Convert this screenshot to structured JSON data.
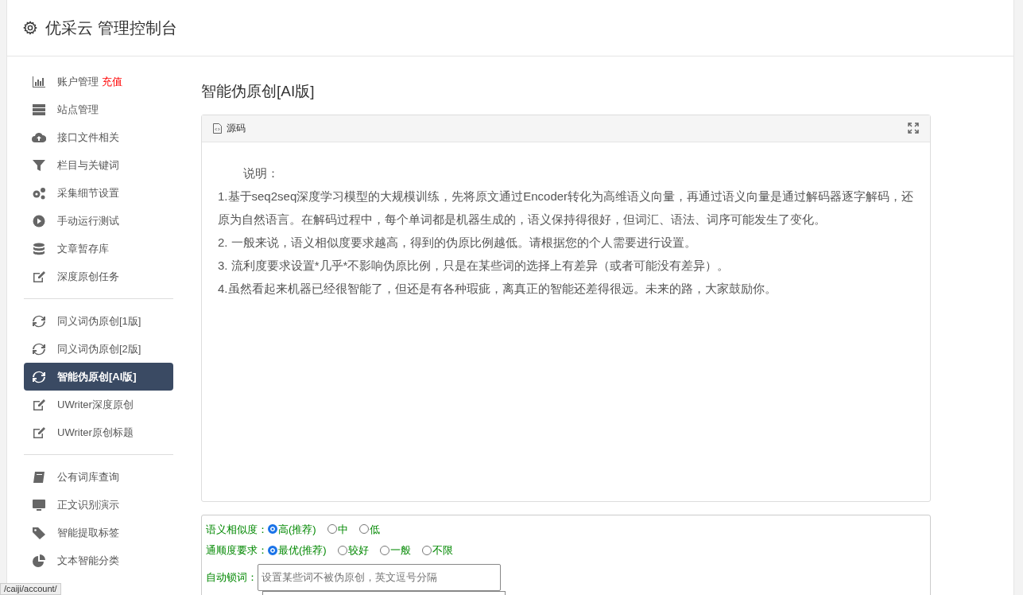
{
  "header": {
    "title": "优采云 管理控制台"
  },
  "sidebar": {
    "groups": [
      [
        {
          "label": "账户管理",
          "badge": "充值",
          "selected": false
        },
        {
          "label": "站点管理",
          "selected": false
        },
        {
          "label": "接口文件相关",
          "selected": false
        },
        {
          "label": "栏目与关键词",
          "selected": false
        },
        {
          "label": "采集细节设置",
          "selected": false
        },
        {
          "label": "手动运行测试",
          "selected": false
        },
        {
          "label": "文章暂存库",
          "selected": false
        },
        {
          "label": "深度原创任务",
          "selected": false
        }
      ],
      [
        {
          "label": "同义词伪原创[1版]",
          "selected": false
        },
        {
          "label": "同义词伪原创[2版]",
          "selected": false
        },
        {
          "label": "智能伪原创[AI版]",
          "selected": true
        },
        {
          "label": "UWriter深度原创",
          "selected": false
        },
        {
          "label": "UWriter原创标题",
          "selected": false
        }
      ],
      [
        {
          "label": "公有词库查询",
          "selected": false
        },
        {
          "label": "正文识别演示",
          "selected": false
        },
        {
          "label": "智能提取标签",
          "selected": false
        },
        {
          "label": "文本智能分类",
          "selected": false
        }
      ]
    ]
  },
  "page_title": "智能伪原创[AI版]",
  "editor": {
    "tab": "源码",
    "lines": [
      "说明：",
      "1.基于seq2seq深度学习模型的大规模训练，先将原文通过Encoder转化为高维语义向量，再通过语义向量是通过解码器逐字解码，还原为自然语言。在解码过程中，每个单词都是机器生成的，语义保持得很好，但词汇、语法、词序可能发生了变化。",
      "2. 一般来说，语义相似度要求越高，得到的伪原比例越低。请根据您的个人需要进行设置。",
      "3. 流利度要求设置*几乎*不影响伪原比例，只是在某些词的选择上有差异（或者可能没有差异）。",
      "4.虽然看起来机器已经很智能了，但还是有各种瑕疵，离真正的智能还差得很远。未来的路，大家鼓励你。"
    ]
  },
  "form": {
    "radio_groups": [
      {
        "label": "语义相似度：",
        "options": [
          {
            "label": "高(推荐)",
            "selected": true
          },
          {
            "label": "中",
            "selected": false
          },
          {
            "label": "低",
            "selected": false
          }
        ]
      },
      {
        "label": "通顺度要求：",
        "options": [
          {
            "label": "最优(推荐)",
            "selected": true
          },
          {
            "label": "较好",
            "selected": false
          },
          {
            "label": "一般",
            "selected": false
          },
          {
            "label": "不限",
            "selected": false
          }
        ]
      }
    ],
    "lock_words": {
      "label": "自动锁词：",
      "placeholder": "设置某些词不被伪原创，英文逗号分隔"
    }
  },
  "status_bar": {
    "url": "/caiji/account/"
  }
}
